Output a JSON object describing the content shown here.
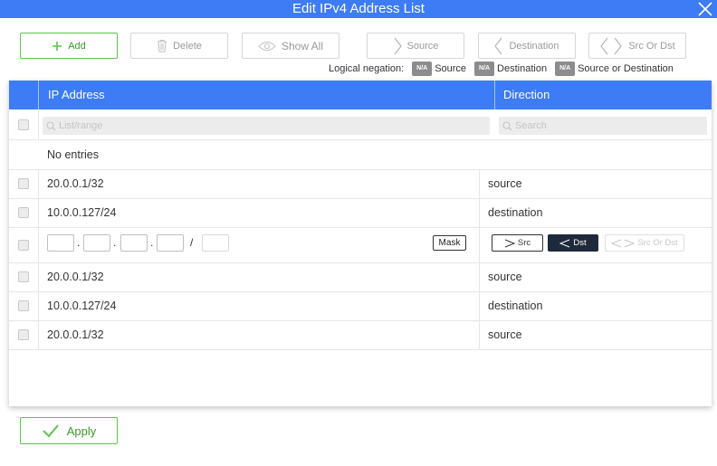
{
  "window": {
    "title": "Edit IPv4 Address List"
  },
  "toolbar": {
    "add_label": "Add",
    "delete_label": "Delete",
    "show_all_label": "Show All",
    "source_label": "Source",
    "destination_label": "Destination",
    "src_or_dst_label": "Src Or Dst"
  },
  "legend": {
    "label": "Logical negation:",
    "badge": "N/A",
    "items": [
      "Source",
      "Destination",
      "Source or Destination"
    ]
  },
  "table": {
    "columns": [
      "IP Address",
      "Direction"
    ],
    "filter_placeholders": {
      "ip": "List/range",
      "direction": "Search"
    },
    "empty_text": "No entries",
    "rows_before": [
      {
        "ip": "20.0.0.1/32",
        "direction": "source"
      },
      {
        "ip": "10.0.0.127/24",
        "direction": "destination"
      }
    ],
    "editor": {
      "slash": "/",
      "mask_label": "Mask",
      "src_label": "Src",
      "dst_label": "Dst",
      "both_label": "Src Or Dst",
      "selected_direction": "Dst"
    },
    "rows_after": [
      {
        "ip": "20.0.0.1/32",
        "direction": "source"
      },
      {
        "ip": "10.0.0.127/24",
        "direction": "destination"
      },
      {
        "ip": "20.0.0.1/32",
        "direction": "source"
      }
    ]
  },
  "footer": {
    "apply_label": "Apply"
  },
  "colors": {
    "accent": "#3d7cf5",
    "green": "#5cc44b",
    "dark_button": "#1e2a3c"
  }
}
